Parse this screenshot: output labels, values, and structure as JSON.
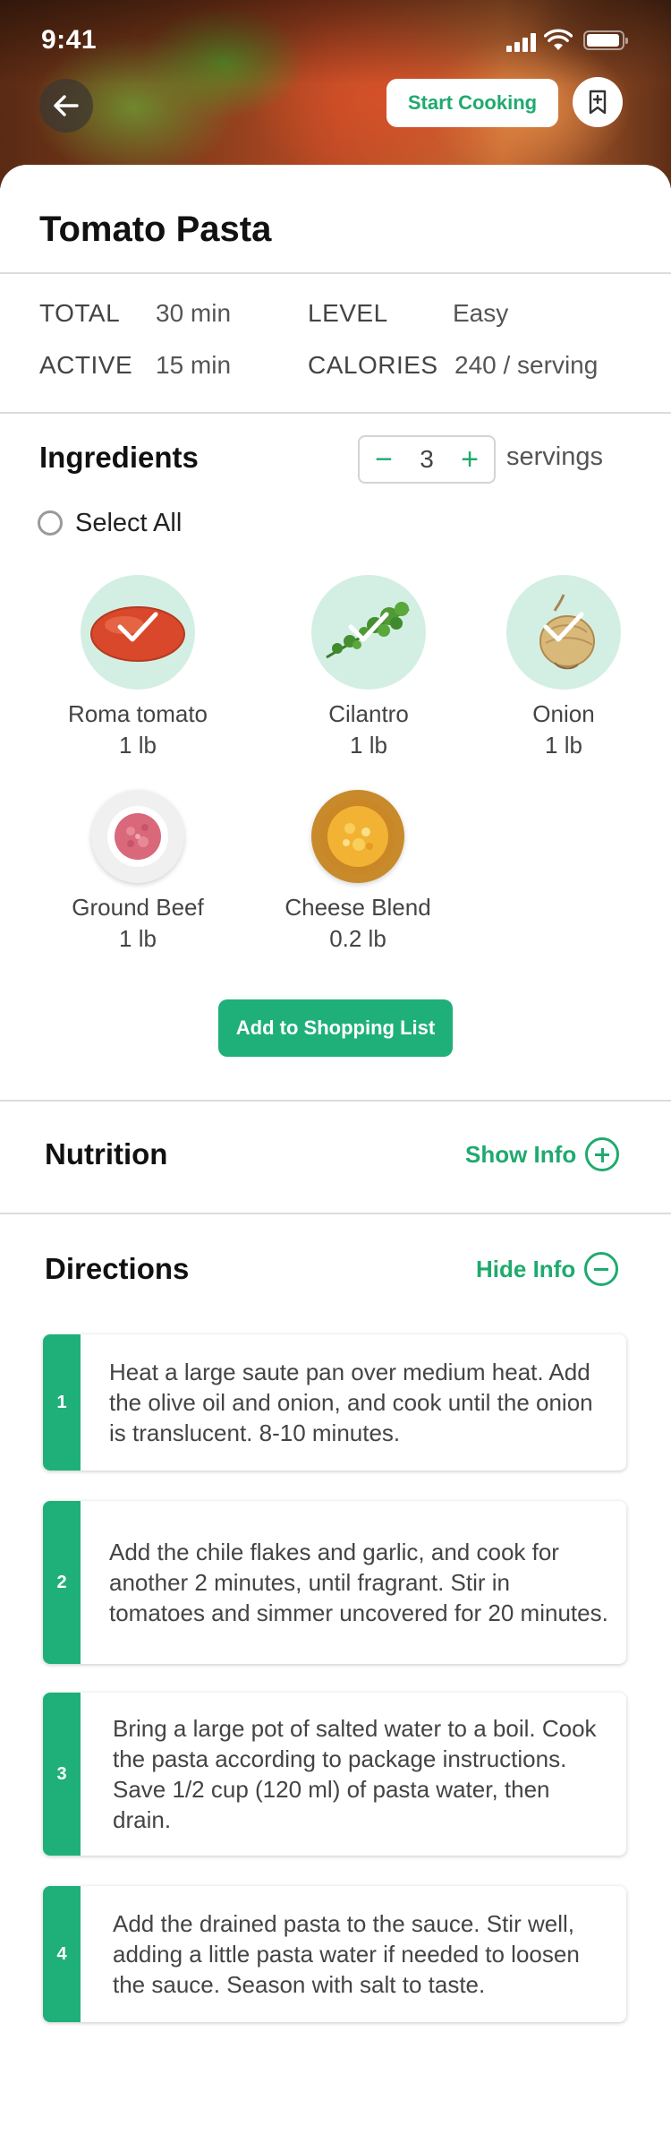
{
  "status_bar": {
    "time": "9:41"
  },
  "header": {
    "start_cooking_label": "Start Cooking",
    "back_icon": "arrow-left-icon",
    "bookmark_icon": "bookmark-plus-icon"
  },
  "recipe": {
    "title": "Tomato Pasta"
  },
  "stats": {
    "total_label": "TOTAL",
    "total_value": "30 min",
    "active_label": "ACTIVE",
    "active_value": "15 min",
    "level_label": "LEVEL",
    "level_value": "Easy",
    "calories_label": "CALORIES",
    "calories_value": "240 / serving"
  },
  "ingredients": {
    "title": "Ingredients",
    "servings_count": "3",
    "servings_label": "servings",
    "minus_symbol": "−",
    "plus_symbol": "+",
    "select_all_label": "Select All",
    "items": [
      {
        "name": "Roma tomato",
        "qty": "1 lb",
        "selected": true
      },
      {
        "name": "Cilantro",
        "qty": "1 lb",
        "selected": true
      },
      {
        "name": "Onion",
        "qty": "1 lb",
        "selected": true
      },
      {
        "name": "Ground Beef",
        "qty": "1 lb",
        "selected": false
      },
      {
        "name": "Cheese Blend",
        "qty": "0.2 lb",
        "selected": false
      }
    ],
    "add_button_label": "Add to Shopping List"
  },
  "nutrition": {
    "title": "Nutrition",
    "toggle_label": "Show Info"
  },
  "directions": {
    "title": "Directions",
    "toggle_label": "Hide Info",
    "steps": [
      {
        "number": "1",
        "text": "Heat a large saute pan over medium heat. Add the olive oil and onion, and cook until the onion is translucent. 8-10 minutes."
      },
      {
        "number": "2",
        "text": "Add the chile flakes and garlic, and cook for another 2 minutes, until fragrant. Stir in tomatoes and simmer uncovered for 20 minutes."
      },
      {
        "number": "3",
        "text": "Bring a large pot of salted water to a boil. Cook the pasta according to package instructions. Save 1/2 cup (120 ml) of pasta water, then drain."
      },
      {
        "number": "4",
        "text": "Add the drained pasta to the sauce. Stir well, adding a little pasta water if needed to loosen the sauce. Season with salt to taste."
      }
    ]
  },
  "colors": {
    "accent": "#1faa6e",
    "selected_bg": "#d3efe4",
    "divider": "#dcdcdc"
  }
}
